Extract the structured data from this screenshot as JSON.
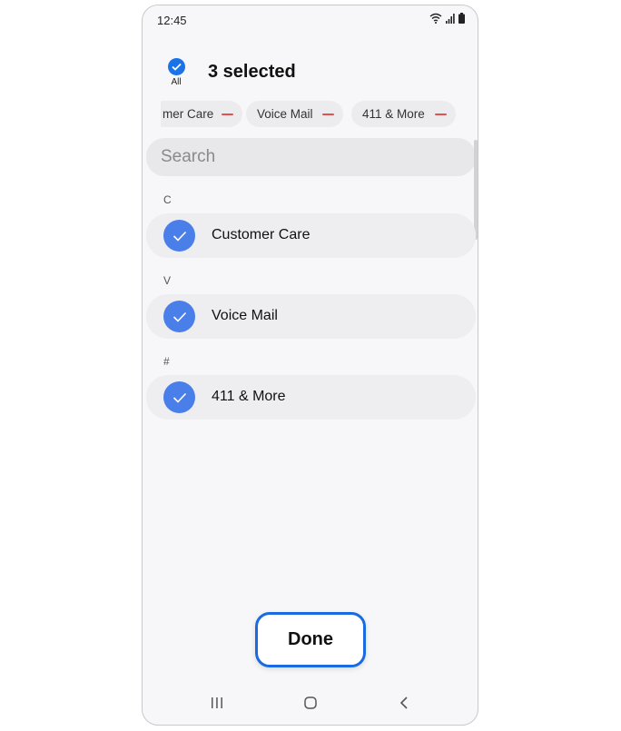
{
  "status_bar": {
    "time": "12:45"
  },
  "header": {
    "all_label": "All",
    "title": "3 selected"
  },
  "chips": [
    {
      "label": "mer Care"
    },
    {
      "label": "Voice Mail"
    },
    {
      "label": "411 & More"
    }
  ],
  "search": {
    "placeholder": "Search"
  },
  "sections": [
    {
      "letter": "C",
      "contact": "Customer Care"
    },
    {
      "letter": "V",
      "contact": "Voice Mail"
    },
    {
      "letter": "#",
      "contact": "411 & More"
    }
  ],
  "done_button": {
    "label": "Done"
  },
  "colors": {
    "accent": "#1a73e8",
    "check_circle": "#4a7fea",
    "chip_remove": "#e05252"
  }
}
